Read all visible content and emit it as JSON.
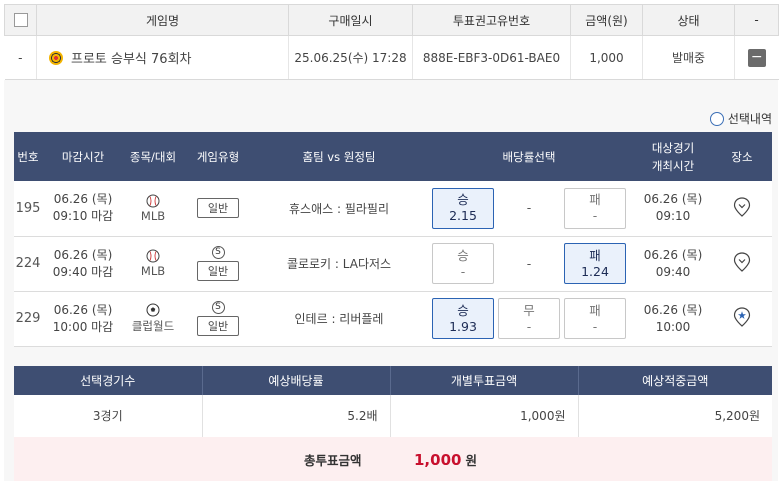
{
  "ticket_table": {
    "headers": [
      "게임명",
      "구매일시",
      "투표권고유번호",
      "금액(원)",
      "상태",
      "-"
    ],
    "row": {
      "index": "-",
      "game_name": "프로토 승부식 76회차",
      "purchase_time": "25.06.25(수) 17:28",
      "ticket_id": "888E-EBF3-0D61-BAE0",
      "amount": "1,000",
      "status": "발매중",
      "action": "−"
    }
  },
  "select_history_label": "선택내역",
  "match_table": {
    "headers": {
      "no": "번호",
      "deadline": "마감시간",
      "sport": "종목/대회",
      "type": "게임유형",
      "teams": "홈팀 vs 원정팀",
      "odds": "배당률선택",
      "target_line1": "대상경기",
      "target_line2": "개최시간",
      "venue": "장소"
    },
    "rows": [
      {
        "no": "195",
        "deadline_date": "06.26 (목)",
        "deadline_time": "09:10 마감",
        "sport": "MLB",
        "s_badge": "",
        "type": "일반",
        "teams": "휴스애스 : 필라필리",
        "win_label": "승",
        "win_value": "2.15",
        "draw_label": "",
        "draw_value": "-",
        "lose_label": "패",
        "lose_value": "-",
        "target_date": "06.26 (목)",
        "target_time": "09:10"
      },
      {
        "no": "224",
        "deadline_date": "06.26 (목)",
        "deadline_time": "09:40 마감",
        "sport": "MLB",
        "s_badge": "S",
        "type": "일반",
        "teams": "콜로로키 : LA다저스",
        "win_label": "승",
        "win_value": "-",
        "draw_label": "",
        "draw_value": "-",
        "lose_label": "패",
        "lose_value": "1.24",
        "target_date": "06.26 (목)",
        "target_time": "09:40"
      },
      {
        "no": "229",
        "deadline_date": "06.26 (목)",
        "deadline_time": "10:00 마감",
        "sport": "클럽월드",
        "s_badge": "S",
        "type": "일반",
        "teams": "인테르 : 리버플레",
        "win_label": "승",
        "win_value": "1.93",
        "draw_label": "무",
        "draw_value": "-",
        "lose_label": "패",
        "lose_value": "-",
        "target_date": "06.26 (목)",
        "target_time": "10:00"
      }
    ]
  },
  "summary": {
    "headers": [
      "선택경기수",
      "예상배당률",
      "개별투표금액",
      "예상적중금액"
    ],
    "values": [
      "3경기",
      "5.2배",
      "1,000원",
      "5,200원"
    ]
  },
  "total": {
    "label": "총투표금액",
    "amount": "1,000",
    "unit": "원"
  },
  "colors": {
    "header_navy": "#3e4e72",
    "selected_border": "#2b63b3",
    "total_red": "#c8102e",
    "total_bg": "#fdeff0"
  }
}
